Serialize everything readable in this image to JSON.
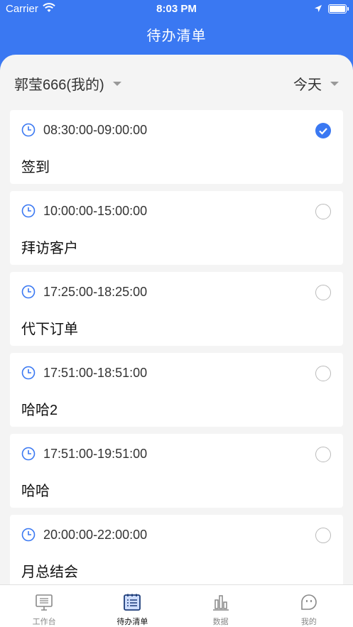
{
  "status_bar": {
    "carrier": "Carrier",
    "time": "8:03 PM"
  },
  "header": {
    "title": "待办清单"
  },
  "filters": {
    "person": "郭莹666(我的)",
    "date": "今天"
  },
  "tasks": [
    {
      "time": "08:30:00-09:00:00",
      "title": "签到",
      "done": true
    },
    {
      "time": "10:00:00-15:00:00",
      "title": "拜访客户",
      "done": false
    },
    {
      "time": "17:25:00-18:25:00",
      "title": "代下订单",
      "done": false
    },
    {
      "time": "17:51:00-18:51:00",
      "title": "哈哈2",
      "done": false
    },
    {
      "time": "17:51:00-19:51:00",
      "title": "哈哈",
      "done": false
    },
    {
      "time": "20:00:00-22:00:00",
      "title": "月总结会",
      "done": false
    }
  ],
  "tab_bar": {
    "items": [
      {
        "label": "工作台",
        "icon": "workbench-icon",
        "active": false
      },
      {
        "label": "待办清单",
        "icon": "todo-list-icon",
        "active": true
      },
      {
        "label": "数据",
        "icon": "bar-chart-icon",
        "active": false
      },
      {
        "label": "我的",
        "icon": "profile-face-icon",
        "active": false
      }
    ]
  },
  "colors": {
    "brand": "#3a78f2",
    "background": "#f4f4f4"
  }
}
